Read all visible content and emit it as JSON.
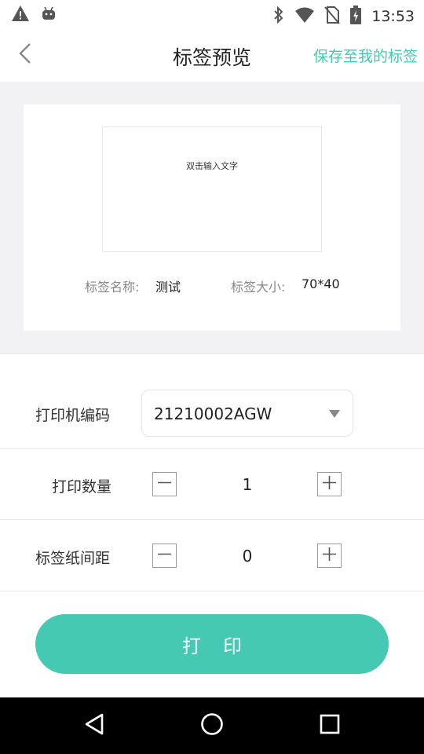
{
  "status_bar": {
    "time": "13:53",
    "left_icons": [
      "warning-icon",
      "android-icon"
    ],
    "right_icons": [
      "bluetooth-icon",
      "wifi-icon",
      "no-sim-icon",
      "battery-charging-icon"
    ]
  },
  "header": {
    "title": "标签预览",
    "save_link": "保存至我的标签"
  },
  "preview": {
    "canvas_text": "双击输入文字",
    "name_label": "标签名称:",
    "name_value": "测试",
    "size_label": "标签大小:",
    "size_value": "70*40"
  },
  "form": {
    "printer_code": {
      "label": "打印机编码",
      "value": "21210002AGW"
    },
    "print_count": {
      "label": "打印数量",
      "value": "1"
    },
    "label_gap": {
      "label": "标签纸间距",
      "value": "0"
    }
  },
  "actions": {
    "print_label": "打印"
  },
  "system_nav": [
    "back-icon",
    "home-icon",
    "recents-icon"
  ],
  "colors": {
    "accent": "#45c9b3",
    "preview_bg": "#f2f2f5",
    "system_nav_bg": "#000000"
  }
}
